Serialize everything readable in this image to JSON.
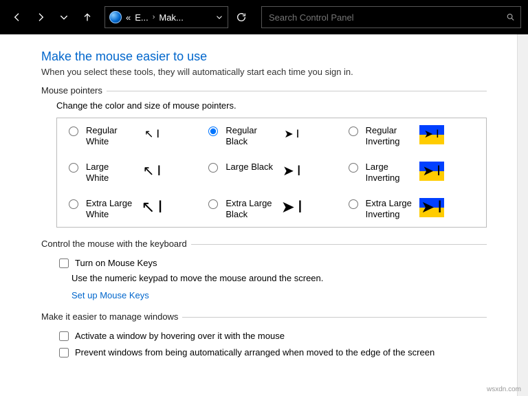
{
  "nav": {
    "crumb1": "E...",
    "crumb2": "Mak...",
    "back_chevrons": "«",
    "sep": "›"
  },
  "search": {
    "placeholder": "Search Control Panel"
  },
  "page": {
    "title": "Make the mouse easier to use",
    "subtitle": "When you select these tools, they will automatically start each time you sign in."
  },
  "mousePointers": {
    "legend": "Mouse pointers",
    "desc": "Change the color and size of mouse pointers.",
    "options": [
      {
        "label": "Regular White",
        "selected": false
      },
      {
        "label": "Regular Black",
        "selected": true
      },
      {
        "label": "Regular Inverting",
        "selected": false
      },
      {
        "label": "Large White",
        "selected": false
      },
      {
        "label": "Large Black",
        "selected": false
      },
      {
        "label": "Large Inverting",
        "selected": false
      },
      {
        "label": "Extra Large White",
        "selected": false
      },
      {
        "label": "Extra Large Black",
        "selected": false
      },
      {
        "label": "Extra Large Inverting",
        "selected": false
      }
    ]
  },
  "keyboard": {
    "legend": "Control the mouse with the keyboard",
    "mouseKeysLabel": "Turn on Mouse Keys",
    "mouseKeysDesc": "Use the numeric keypad to move the mouse around the screen.",
    "link": "Set up Mouse Keys"
  },
  "windows": {
    "legend": "Make it easier to manage windows",
    "opt1": "Activate a window by hovering over it with the mouse",
    "opt2": "Prevent windows from being automatically arranged when moved to the edge of the screen"
  },
  "watermark": "wsxdn.com"
}
